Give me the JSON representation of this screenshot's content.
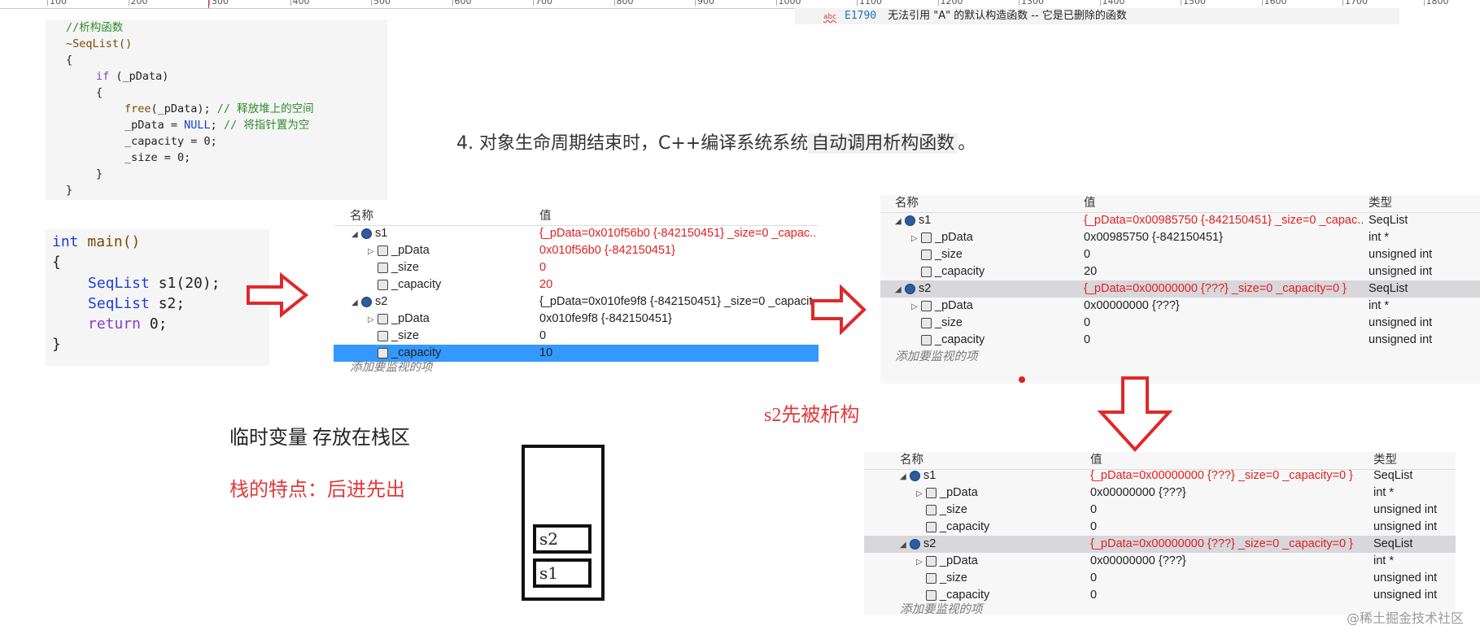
{
  "ruler": {
    "ticks": [
      "100",
      "200",
      "300",
      "400",
      "500",
      "600",
      "700",
      "800",
      "900",
      "1000",
      "1100",
      "1200",
      "1300",
      "1400",
      "1500",
      "1600",
      "1700",
      "1800"
    ]
  },
  "error": {
    "icon": "abc",
    "code": "E1790",
    "message": "无法引用 \"A\" 的默认构造函数 -- 它是已删除的函数"
  },
  "dtor_code": {
    "comment": "//析构函数",
    "sig": "~SeqList()",
    "open": "{",
    "if_kw": "if",
    "if_cond": " (_pData)",
    "inner_open": "{",
    "free_fn": "free",
    "free_arg": "(_pData); ",
    "free_cmt": "// 释放堆上的空间",
    "null_a": "_pData = ",
    "null_kw": "NULL",
    "null_b": "; ",
    "null_cmt": "// 将指针置为空",
    "cap_line": "_capacity = 0;",
    "size_line": "_size = 0;",
    "inner_close": "}",
    "close": "}"
  },
  "main_code": {
    "int_kw": "int",
    "main_sig": " main()",
    "open": "{",
    "type1": "SeqList",
    "decl1": " s1(20);",
    "type2": "SeqList",
    "decl2": " s2;",
    "ret_kw": "return",
    "ret_val": " 0;",
    "close": "}"
  },
  "note4": {
    "text": "4. 对象生命周期结束时，C++编译系统系统",
    "highlight": "自动调用析构函数",
    "end": "。"
  },
  "watch1": {
    "col_name": "名称",
    "col_value": "值",
    "rows": [
      {
        "name": "s1",
        "value": "{_pData=0x010f56b0 {-842150451} _size=0 _capac..."
      },
      {
        "name": "_pData",
        "value": "0x010f56b0 {-842150451}"
      },
      {
        "name": "_size",
        "value": "0"
      },
      {
        "name": "_capacity",
        "value": "20"
      },
      {
        "name": "s2",
        "value": "{_pData=0x010fe9f8 {-842150451} _size=0 _capacit..."
      },
      {
        "name": "_pData",
        "value": "0x010fe9f8 {-842150451}"
      },
      {
        "name": "_size",
        "value": "0"
      },
      {
        "name": "_capacity",
        "value": "10"
      }
    ],
    "add": "添加要监视的项"
  },
  "watch2": {
    "col_name": "名称",
    "col_value": "值",
    "col_type": "类型",
    "rows": [
      {
        "name": "s1",
        "value": "{_pData=0x00985750 {-842150451} _size=0 _capac...",
        "type": "SeqList"
      },
      {
        "name": "_pData",
        "value": "0x00985750 {-842150451}",
        "type": "int *"
      },
      {
        "name": "_size",
        "value": "0",
        "type": "unsigned int"
      },
      {
        "name": "_capacity",
        "value": "20",
        "type": "unsigned int"
      },
      {
        "name": "s2",
        "value": "{_pData=0x00000000 {???} _size=0 _capacity=0 }",
        "type": "SeqList"
      },
      {
        "name": "_pData",
        "value": "0x00000000 {???}",
        "type": "int *"
      },
      {
        "name": "_size",
        "value": "0",
        "type": "unsigned int"
      },
      {
        "name": "_capacity",
        "value": "0",
        "type": "unsigned int"
      }
    ],
    "add": "添加要监视的项"
  },
  "watch3": {
    "col_name": "名称",
    "col_value": "值",
    "col_type": "类型",
    "rows": [
      {
        "name": "s1",
        "value": "{_pData=0x00000000 {???} _size=0 _capacity=0 }",
        "type": "SeqList"
      },
      {
        "name": "_pData",
        "value": "0x00000000 {???}",
        "type": "int *"
      },
      {
        "name": "_size",
        "value": "0",
        "type": "unsigned int"
      },
      {
        "name": "_capacity",
        "value": "0",
        "type": "unsigned int"
      },
      {
        "name": "s2",
        "value": "{_pData=0x00000000 {???} _size=0 _capacity=0 }",
        "type": "SeqList"
      },
      {
        "name": "_pData",
        "value": "0x00000000 {???}",
        "type": "int *"
      },
      {
        "name": "_size",
        "value": "0",
        "type": "unsigned int"
      },
      {
        "name": "_capacity",
        "value": "0",
        "type": "unsigned int"
      }
    ],
    "add": "添加要监视的项"
  },
  "annot": {
    "s2_first": "s2先被析构",
    "tmp_vars": "临时变量  存放在栈区",
    "stack_feature": "栈的特点：后进先出",
    "box_s2": "s2",
    "box_s1": "s1"
  },
  "watermark": "@稀土掘金技术社区",
  "colors": {
    "error_red": "#e02020",
    "selection": "#3399ff",
    "arrow_red": "#e0282a"
  }
}
